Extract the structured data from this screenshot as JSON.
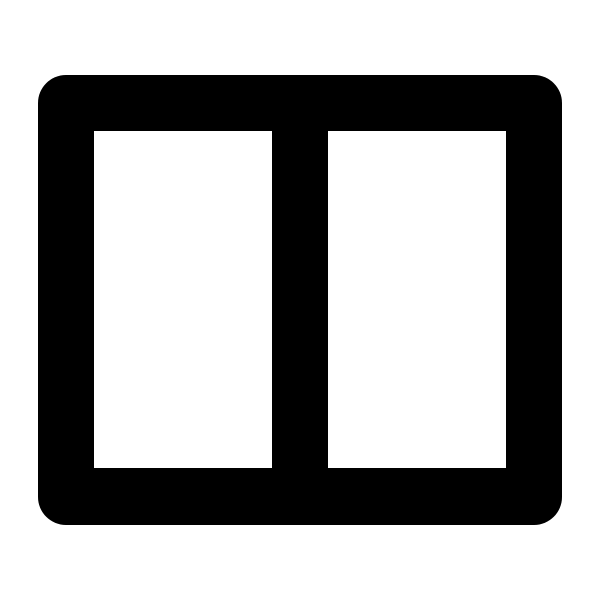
{
  "icon": {
    "name": "split-view-columns-icon",
    "colors": {
      "stroke": "#000000",
      "fill": "#ffffff",
      "background": "#ffffff"
    }
  }
}
